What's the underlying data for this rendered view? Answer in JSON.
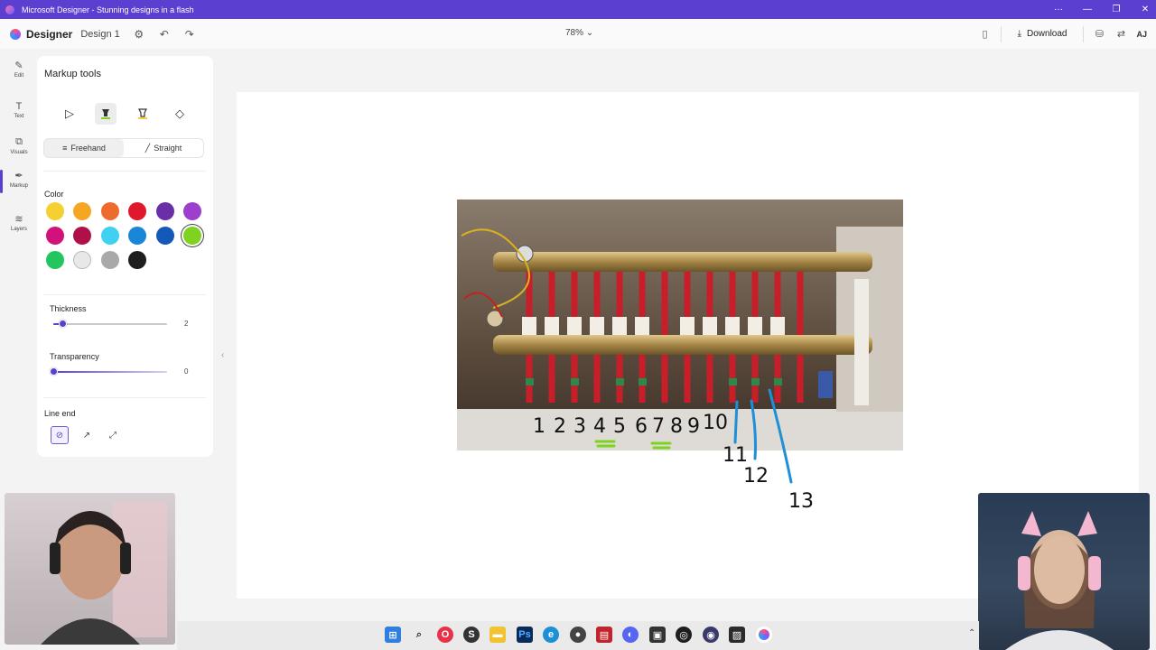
{
  "window": {
    "title": "Microsoft Designer - Stunning designs in a flash",
    "controls": [
      "···",
      "—",
      "❐",
      "✕"
    ]
  },
  "header": {
    "brand": "Designer",
    "design_name": "Design 1",
    "zoom": "78%",
    "download_label": "Download",
    "avatar_initials": "AJ"
  },
  "rail": {
    "items": [
      {
        "label": "Edit",
        "icon": "✎"
      },
      {
        "label": "Text",
        "icon": "T"
      },
      {
        "label": "Visuals",
        "icon": "⧉"
      },
      {
        "label": "Markup",
        "icon": "✒"
      },
      {
        "label": "Layers",
        "icon": "≋"
      }
    ]
  },
  "panel": {
    "title": "Markup tools",
    "modes": [
      "Freehand",
      "Straight"
    ],
    "color_label": "Color",
    "colors": [
      "#f5d033",
      "#f5a623",
      "#ee6b2b",
      "#e0182d",
      "#6a2fa8",
      "#9b3fcc",
      "#d1127a",
      "#b0104a",
      "#3ed1f0",
      "#1a86d6",
      "#1458b8",
      "#7ed321",
      "#22c55e",
      "#e8e8e8",
      "#a9a9a9",
      "#1e1e1e"
    ],
    "selected_color": "#7ed321",
    "thickness_label": "Thickness",
    "thickness_value": "2",
    "thickness_fraction": 0.08,
    "transparency_label": "Transparency",
    "transparency_value": "0",
    "transparency_fraction": 0,
    "line_end_label": "Line end"
  },
  "canvas": {
    "numbers": [
      "1",
      "2",
      "3",
      "4",
      "5",
      "6",
      "7",
      "8",
      "9",
      "10",
      "11",
      "12",
      "13"
    ]
  },
  "colors": {
    "accent": "#5b3fd1",
    "annotation_blue": "#1f8fd8",
    "annotation_green": "#7ed321"
  }
}
